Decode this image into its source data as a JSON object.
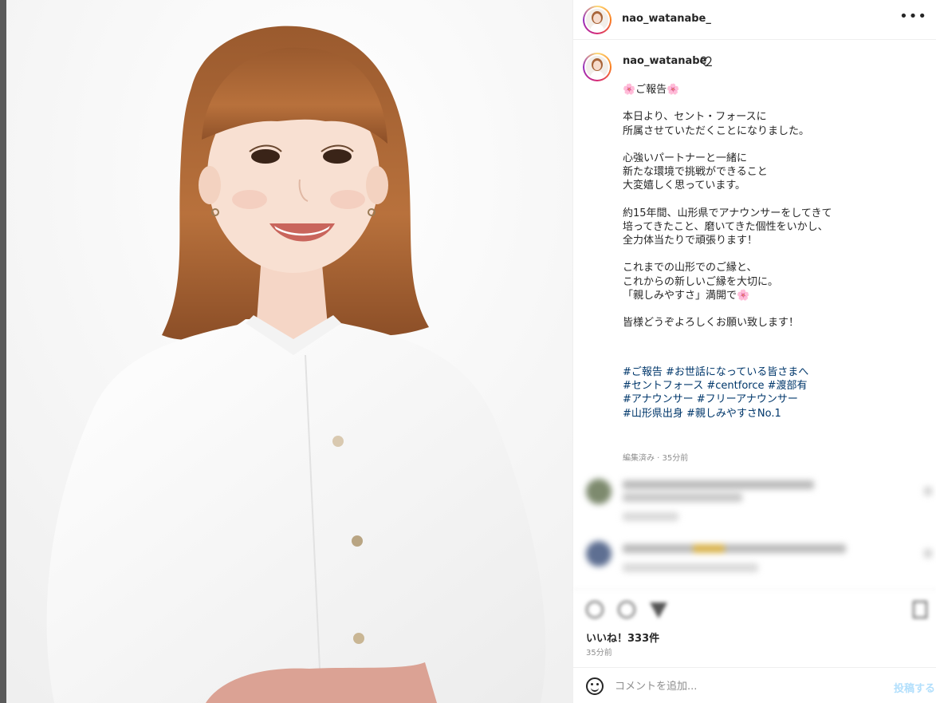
{
  "post": {
    "username": "nao_watanabe_",
    "more_label": "•••",
    "caption_lines": [
      "🌸ご報告🌸",
      "",
      "本日より、セント・フォースに",
      "所属させていただくことになりました。",
      "",
      "心強いパートナーと一緒に",
      "新たな環境で挑戦ができること",
      "大変嬉しく思っています。",
      "",
      "約15年間、山形県でアナウンサーをしてきて",
      "培ってきたこと、磨いてきた個性をいかし、",
      "全力体当たりで頑張ります！",
      "",
      "これまでの山形でのご縁と、",
      "これからの新しいご縁を大切に。",
      "「親しみやすさ」満開で🌸",
      "",
      "皆様どうぞよろしくお願い致します！"
    ],
    "hashtag_lines": [
      "#ご報告 #お世話になっている皆さまへ",
      "#セントフォース #centforce #渡部有",
      "#アナウンサー #フリーアナウンサー",
      "#山形県出身 #親しみやすさNo.1"
    ],
    "edited_label": "編集済み · 35分前",
    "likes_label": "いいね！333件",
    "time_label": "35分前"
  },
  "comment_box": {
    "placeholder": "コメントを追加...",
    "post_label": "投稿する"
  },
  "colors": {
    "hashtag": "#00376b",
    "post_button_disabled": "#b2dffc",
    "meta_gray": "#8e8e8e"
  },
  "icons": [
    "more-icon",
    "heart-icon",
    "like-icon",
    "comment-icon",
    "share-icon",
    "save-icon",
    "emoji-icon"
  ]
}
